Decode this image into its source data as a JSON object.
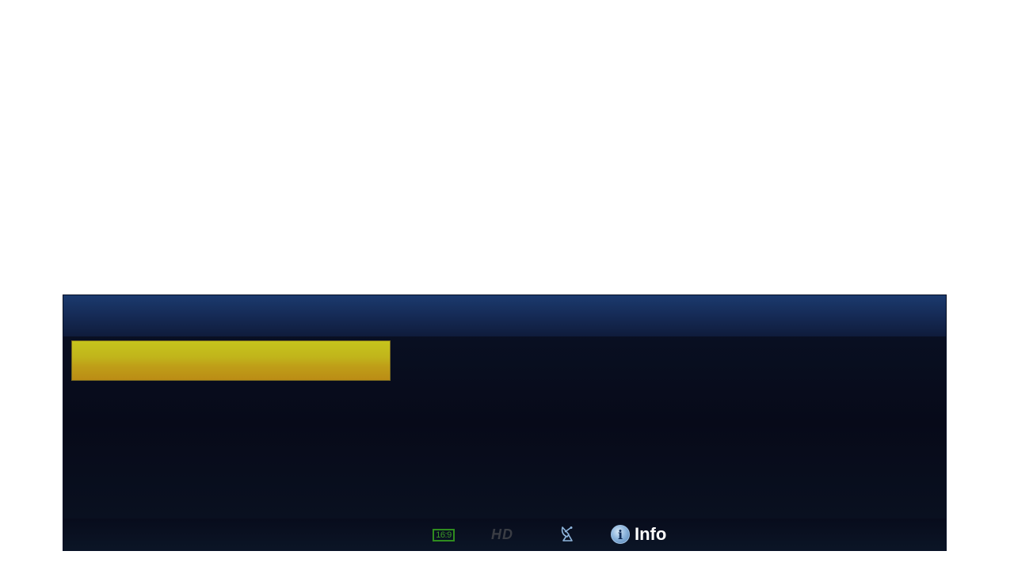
{
  "infobar": {
    "channel_name": "",
    "status": {
      "aspect_badge": "16:9",
      "hd_badge": "HD",
      "satellite_icon": "satellite-dish-icon",
      "info_icon": "info-icon",
      "info_glyph": "i",
      "info_label": "Info"
    }
  },
  "colors": {
    "header_blue": "#1b3a6e",
    "panel_dark": "#070a19",
    "highlight_gold": "#c6c41c",
    "aspect_green": "#3a9a25",
    "hd_inactive": "#3a3d44",
    "satellite_blue": "#8fb6dd"
  }
}
